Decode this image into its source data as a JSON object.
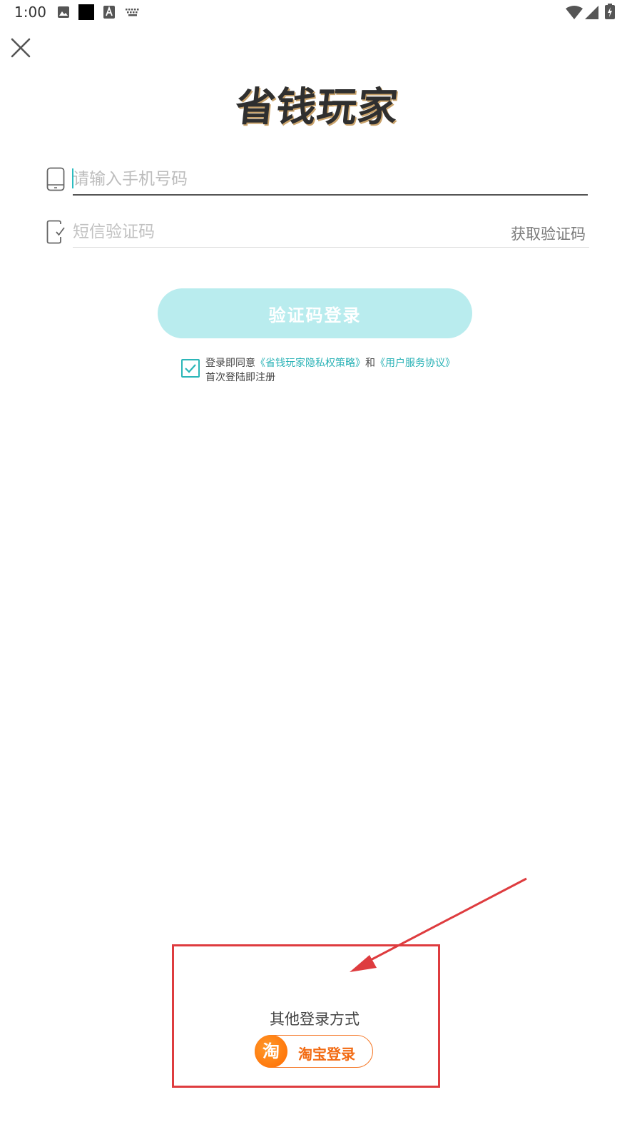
{
  "status_bar": {
    "time": "1:00",
    "icons": [
      "image-icon",
      "square-icon",
      "text-a-icon",
      "keyboard-icon",
      "wifi-icon",
      "signal-icon",
      "battery-icon"
    ]
  },
  "header": {
    "close_icon": "close-icon"
  },
  "logo": {
    "text": "省钱玩家"
  },
  "form": {
    "phone_placeholder": "请输入手机号码",
    "phone_value": "",
    "sms_placeholder": "短信验证码",
    "sms_value": "",
    "get_code_label": "获取验证码",
    "login_button_label": "验证码登录"
  },
  "agreement": {
    "checked": true,
    "prefix": "登录即同意",
    "privacy_link": "《省钱玩家隐私权策略》",
    "conjunction": "和",
    "terms_link": "《用户服务协议》",
    "note": "首次登陆即注册"
  },
  "other_login": {
    "title": "其他登录方式",
    "taobao_logo_char": "淘",
    "taobao_label": "淘宝登录"
  },
  "colors": {
    "accent": "#2bb6b8",
    "button_disabled": "#b9ecee",
    "taobao_orange": "#f57a2a",
    "annotation_red": "#de3c3f"
  }
}
